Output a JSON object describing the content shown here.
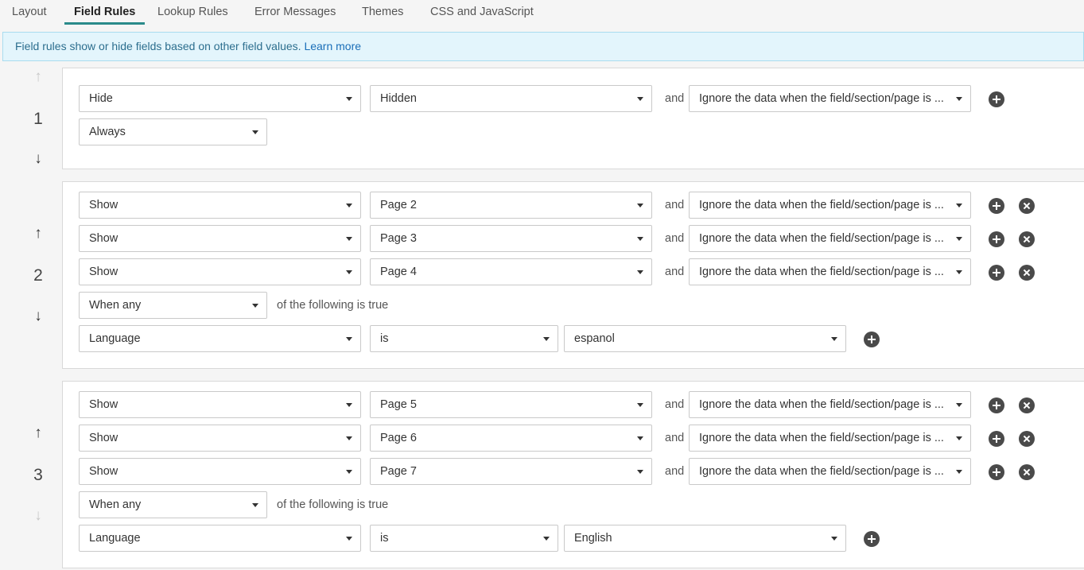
{
  "tabs": [
    "Layout",
    "Field Rules",
    "Lookup Rules",
    "Error Messages",
    "Themes",
    "CSS and JavaScript"
  ],
  "banner": {
    "text": "Field rules show or hide fields based on other field values. ",
    "link": "Learn more"
  },
  "labels": {
    "and": "and",
    "of_following": "of the following is true"
  },
  "icons": {
    "up": "arrow-up-icon",
    "down": "arrow-down-icon",
    "add": "plus-circle-icon",
    "remove": "close-circle-icon"
  },
  "rules": [
    {
      "number": "1",
      "actions": [
        {
          "action": "Hide",
          "target": "Hidden",
          "data": "Ignore the data when the field/section/page is ..."
        }
      ],
      "condition": "Always"
    },
    {
      "number": "2",
      "actions": [
        {
          "action": "Show",
          "target": "Page 2",
          "data": "Ignore the data when the field/section/page is ..."
        },
        {
          "action": "Show",
          "target": "Page 3",
          "data": "Ignore the data when the field/section/page is ..."
        },
        {
          "action": "Show",
          "target": "Page 4",
          "data": "Ignore the data when the field/section/page is ..."
        }
      ],
      "condition": "When any",
      "criteria": [
        {
          "field": "Language",
          "operator": "is",
          "value": "espanol"
        }
      ]
    },
    {
      "number": "3",
      "actions": [
        {
          "action": "Show",
          "target": "Page 5",
          "data": "Ignore the data when the field/section/page is ..."
        },
        {
          "action": "Show",
          "target": "Page 6",
          "data": "Ignore the data when the field/section/page is ..."
        },
        {
          "action": "Show",
          "target": "Page 7",
          "data": "Ignore the data when the field/section/page is ..."
        }
      ],
      "condition": "When any",
      "criteria": [
        {
          "field": "Language",
          "operator": "is",
          "value": "English"
        }
      ]
    }
  ]
}
